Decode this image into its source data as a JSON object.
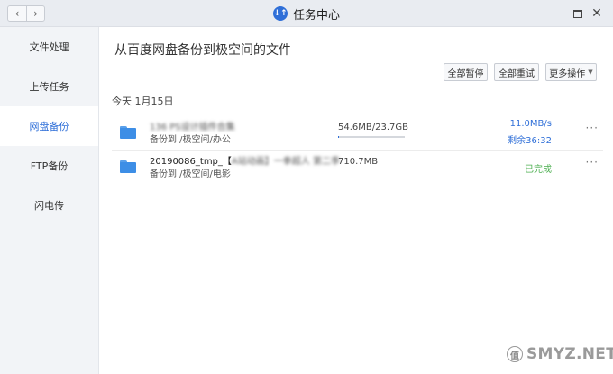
{
  "window": {
    "title": "任务中心",
    "logo_text": "↓↑",
    "back_glyph": "‹",
    "forward_glyph": "›",
    "close_glyph": "✕"
  },
  "sidebar": {
    "items": [
      {
        "label": "文件处理",
        "active": false
      },
      {
        "label": "上传任务",
        "active": false
      },
      {
        "label": "网盘备份",
        "active": true
      },
      {
        "label": "FTP备份",
        "active": false
      },
      {
        "label": "闪电传",
        "active": false
      }
    ]
  },
  "main": {
    "title": "从百度网盘备份到极空间的文件",
    "toolbar": {
      "pause_all": "全部暂停",
      "retry_all": "全部重试",
      "more_ops": "更多操作",
      "caret": "▼"
    },
    "date_label": "今天 1月15日",
    "tasks": [
      {
        "name": "136 PS设计插件合集",
        "dest": "备份到 /极空间/办公",
        "size": "54.6MB/23.7GB",
        "progress": 0.0023,
        "speed": "11.0MB/s",
        "remaining": "剩余36:32",
        "status": "",
        "more": "···"
      },
      {
        "name": "20190086_tmp_【A站动画】一拳超人 第二季",
        "dest": "备份到 /极空间/电影",
        "size": "710.7MB",
        "status": "已完成",
        "more": "···"
      }
    ]
  },
  "watermark": {
    "logo": "值",
    "text": "SMYZ.NET"
  },
  "colors": {
    "accent": "#2f6fd8",
    "done": "#4caf50",
    "sidebar_bg": "#f2f4f7",
    "titlebar_bg": "#e9ecf1"
  }
}
